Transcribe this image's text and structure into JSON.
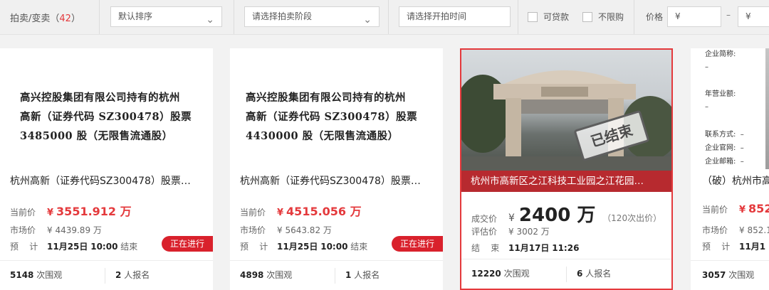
{
  "filters": {
    "title_prefix": "拍卖/变卖（",
    "title_count": "42",
    "title_suffix": "）",
    "sort_value": "默认排序",
    "stage_placeholder": "请选择拍卖阶段",
    "time_placeholder": "请选择开拍时间",
    "loan_label": "可贷款",
    "unlimited_label": "不限购",
    "price_label": "价格",
    "currency": "¥",
    "dash": "–"
  },
  "labels": {
    "current_price": "当前价",
    "market_price": "市场价",
    "forecast_a": "预",
    "forecast_b": "计",
    "deal_price": "成交价",
    "appraised": "评估价",
    "end_a": "结",
    "end_b": "束",
    "ends_suffix": "结束",
    "views_suffix": "次围观",
    "signups_suffix": "人报名",
    "in_progress": "正在进行",
    "finished": "已结束"
  },
  "cards": [
    {
      "doc_lines": [
        "高兴控股集团有限公司持有的杭州",
        "高新（证券代码 SZ300478）股票",
        "3485000 股（无限售流通股）"
      ],
      "title": "杭州高新（证券代码SZ300478）股票…",
      "current_price": "3551.912 万",
      "market_price": "¥ 4439.89 万",
      "end_date": "11月25日",
      "end_time": "10:00",
      "views": "5148",
      "signups": "2"
    },
    {
      "doc_lines": [
        "高兴控股集团有限公司持有的杭州",
        "高新（证券代码 SZ300478）股票",
        "4430000 股（无限售流通股）"
      ],
      "title": "杭州高新（证券代码SZ300478）股票…",
      "current_price": "4515.056 万",
      "market_price": "¥ 5643.82 万",
      "end_date": "11月25日",
      "end_time": "10:00",
      "views": "4898",
      "signups": "1"
    },
    {
      "title": "杭州市高新区之江科技工业园之江花园…",
      "deal_price": "2400 万",
      "bids": "（120次出价）",
      "appraised": "¥ 3002 万",
      "end_date": "11月17日",
      "end_time": "11:26",
      "views": "12220",
      "signups": "6"
    },
    {
      "info": {
        "company_short_label": "企业简称:",
        "company_short_value": "–",
        "revenue_label": "年营业额:",
        "revenue_value": "–",
        "contact_label": "联系方式:",
        "website_label": "企业官网:",
        "email_label": "企业邮箱:",
        "empty": "–"
      },
      "title": "（破）杭州市高",
      "current_price": "852",
      "market_price": "¥ 852.1",
      "end_date": "11月1",
      "views": "3057"
    }
  ]
}
